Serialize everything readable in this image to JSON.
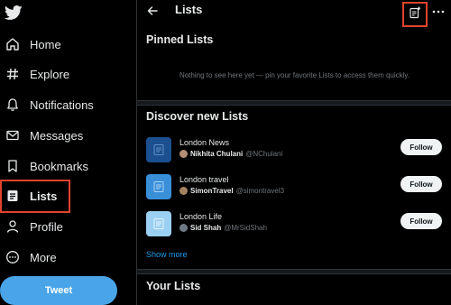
{
  "sidebar": {
    "items": [
      {
        "name": "home",
        "label": "Home",
        "icon": "home-icon"
      },
      {
        "name": "explore",
        "label": "Explore",
        "icon": "hashtag-icon"
      },
      {
        "name": "notifications",
        "label": "Notifications",
        "icon": "bell-icon"
      },
      {
        "name": "messages",
        "label": "Messages",
        "icon": "envelope-icon"
      },
      {
        "name": "bookmarks",
        "label": "Bookmarks",
        "icon": "bookmark-icon"
      },
      {
        "name": "lists",
        "label": "Lists",
        "icon": "list-icon",
        "active": true
      },
      {
        "name": "profile",
        "label": "Profile",
        "icon": "person-icon"
      },
      {
        "name": "more",
        "label": "More",
        "icon": "more-circle-icon"
      }
    ],
    "tweet_label": "Tweet"
  },
  "header": {
    "title": "Lists"
  },
  "pinned": {
    "title": "Pinned Lists",
    "empty_message": "Nothing to see here yet — pin your favorite Lists to access them quickly."
  },
  "discover": {
    "title": "Discover new Lists",
    "lists": [
      {
        "name": "London News",
        "owner": "Nikhita Chulani",
        "handle": "@NChulani",
        "follow": "Follow",
        "thumb_color": "#1c4f8f"
      },
      {
        "name": "London travel",
        "owner": "SimonTravel",
        "handle": "@simontravel3",
        "follow": "Follow",
        "thumb_color": "#3a8fd9"
      },
      {
        "name": "London Life",
        "owner": "Sid Shah",
        "handle": "@MrSidShah",
        "follow": "Follow",
        "thumb_color": "#9bd0f3"
      }
    ],
    "show_more": "Show more"
  },
  "your_lists": {
    "title": "Your Lists"
  },
  "colors": {
    "accent": "#1d9bf0",
    "highlight": "#e0442e",
    "tweet_button": "#4aa5e8"
  }
}
